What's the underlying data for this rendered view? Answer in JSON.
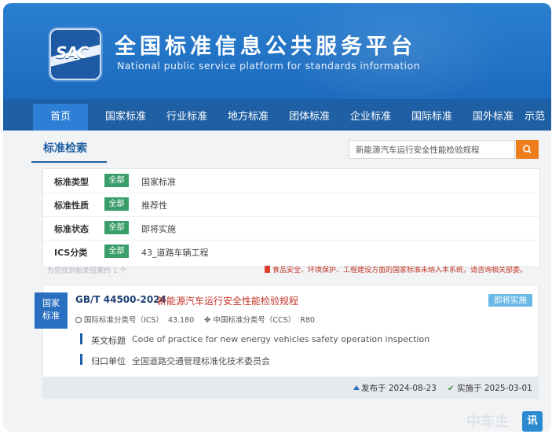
{
  "header": {
    "logo_text": "SAC",
    "title_cn": "全国标准信息公共服务平台",
    "title_en": "National public service platform  for standards information"
  },
  "nav": {
    "items": [
      "首页",
      "国家标准",
      "行业标准",
      "地方标准",
      "团体标准",
      "企业标准",
      "国际标准",
      "国外标准",
      "示范"
    ],
    "active_index": 0
  },
  "search": {
    "section_title": "标准检索",
    "query": "新能源汽车运行安全性能检验规程",
    "button_icon": "search-icon"
  },
  "filters": [
    {
      "label": "标准类型",
      "badge": "全部",
      "value": "国家标准"
    },
    {
      "label": "标准性质",
      "badge": "全部",
      "value": "推荐性"
    },
    {
      "label": "标准状态",
      "badge": "全部",
      "value": "即将实施"
    },
    {
      "label": "ICS分类",
      "badge": "全部",
      "value": "43_道路车辆工程"
    }
  ],
  "results": {
    "count_text": "为您找到相关结果约 1 个",
    "notice_text": "食品安全、环境保护、工程建设方面的国家标准未纳入本系统，请咨询相关部委。"
  },
  "standard": {
    "category": [
      "国家",
      "标准"
    ],
    "code": "GB/T 44500-2024",
    "name": "新能源汽车运行安全性能检验规程",
    "status": "即将实施",
    "ics_label": "国际标准分类号（ICS）",
    "ics_value": "43.180",
    "ccs_label": "中国标准分类号（CCS）",
    "ccs_value": "R80",
    "english_title_label": "英文标题",
    "english_title": "Code of practice for new energy vehicles safety operation inspection",
    "unit_label": "归口单位",
    "unit": "全国道路交通管理标准化技术委员会",
    "published": "发布于 2024-08-23",
    "effective": "实施于 2025-03-01"
  },
  "watermark": {
    "text": "中车主",
    "badge": "讯"
  },
  "colors": {
    "header_blue": "#2a7fd0",
    "nav_blue": "#1f5fa3",
    "badge_green": "#3a9e6a",
    "search_orange": "#ee7d1e",
    "name_red": "#c2332a"
  }
}
